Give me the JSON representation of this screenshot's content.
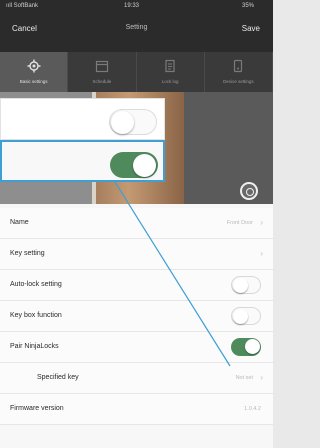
{
  "status_bar": {
    "carrier": "ııll SoftBank",
    "time": "19:33",
    "battery": "35%"
  },
  "nav": {
    "cancel": "Cancel",
    "title": "Setting",
    "save": "Save"
  },
  "tabs": [
    {
      "label": "Basic settings",
      "icon": "gear-icon",
      "active": true
    },
    {
      "label": "Schedule",
      "icon": "calendar-icon",
      "active": false
    },
    {
      "label": "Lock log",
      "icon": "log-icon",
      "active": false
    },
    {
      "label": "Device settings",
      "icon": "device-icon",
      "active": false
    }
  ],
  "callouts": [
    {
      "toggle_state": "off"
    },
    {
      "toggle_state": "on"
    }
  ],
  "rows": [
    {
      "label": "Name",
      "value": "Front Door",
      "type": "chevron"
    },
    {
      "label": "Key setting",
      "value": "",
      "type": "chevron"
    },
    {
      "label": "Auto-lock setting",
      "value": "",
      "type": "toggle",
      "state": "off"
    },
    {
      "label": "Key box function",
      "value": "",
      "type": "toggle",
      "state": "off"
    },
    {
      "label": "Pair NinjaLocks",
      "value": "",
      "type": "toggle",
      "state": "on"
    },
    {
      "label": "Specified key",
      "value": "Not set",
      "type": "chevron",
      "sub": true
    },
    {
      "label": "Firmware version",
      "value": "1.0.4.2",
      "type": "text"
    }
  ],
  "colors": {
    "accent_green": "#4f8a5d",
    "highlight_blue": "#3d9fd6",
    "header": "#2b2b2c"
  }
}
